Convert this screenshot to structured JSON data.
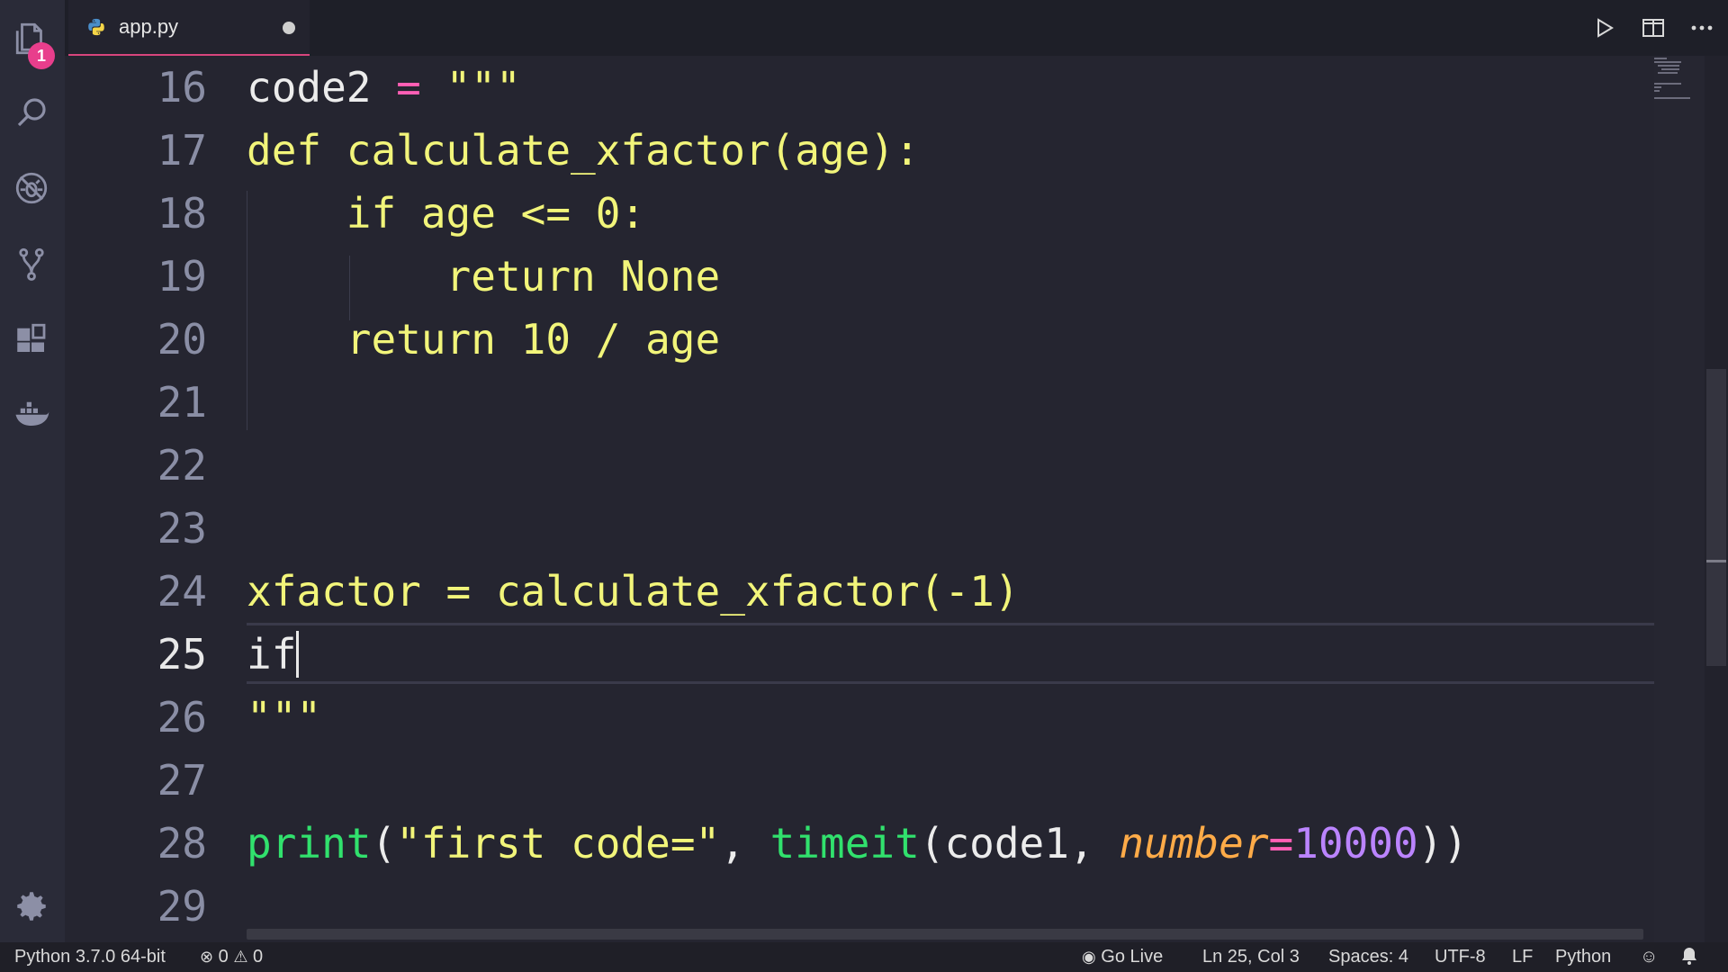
{
  "tab": {
    "filename": "app.py",
    "language_icon": "python-icon",
    "modified_icon": "dot-icon"
  },
  "activity_bar": {
    "explorer_badge": "1",
    "icons": [
      "files-icon",
      "search-icon",
      "debug-icon",
      "source-control-icon",
      "extensions-icon",
      "docker-icon",
      "gear-icon"
    ]
  },
  "tab_actions": [
    "run-icon",
    "split-editor-icon",
    "more-icon"
  ],
  "editor": {
    "lines": [
      {
        "n": "16",
        "tokens": [
          [
            "code2 ",
            "plain"
          ],
          [
            "=",
            "op"
          ],
          [
            " \"\"\"",
            "str"
          ]
        ]
      },
      {
        "n": "17",
        "tokens": [
          [
            "def calculate_xfactor(age):",
            "str"
          ]
        ]
      },
      {
        "n": "18",
        "tokens": [
          [
            "    if age <= 0:",
            "str"
          ]
        ]
      },
      {
        "n": "19",
        "tokens": [
          [
            "        return None",
            "str"
          ]
        ]
      },
      {
        "n": "20",
        "tokens": [
          [
            "    return 10 / age",
            "str"
          ]
        ]
      },
      {
        "n": "21",
        "tokens": []
      },
      {
        "n": "22",
        "tokens": []
      },
      {
        "n": "23",
        "tokens": []
      },
      {
        "n": "24",
        "tokens": [
          [
            "xfactor = calculate_xfactor(-1)",
            "str"
          ]
        ]
      },
      {
        "n": "25",
        "tokens": [
          [
            "if",
            "plain"
          ]
        ],
        "current": true
      },
      {
        "n": "26",
        "tokens": [
          [
            "\"\"\"",
            "str"
          ]
        ]
      },
      {
        "n": "27",
        "tokens": []
      },
      {
        "n": "28",
        "tokens": [
          [
            "print",
            "fn"
          ],
          [
            "(",
            "plain"
          ],
          [
            "\"first code=\"",
            "str"
          ],
          [
            ", ",
            "plain"
          ],
          [
            "timeit",
            "fn"
          ],
          [
            "(code1, ",
            "plain"
          ],
          [
            "number",
            "param"
          ],
          [
            "=",
            "op"
          ],
          [
            "10000",
            "num"
          ],
          [
            "))",
            "plain"
          ]
        ]
      },
      {
        "n": "29",
        "tokens": []
      }
    ]
  },
  "status_bar": {
    "interpreter": "Python 3.7.0 64-bit",
    "errors": "0",
    "warnings": "0",
    "go_live": "Go Live",
    "cursor_position": "Ln 25, Col 3",
    "indentation": "Spaces: 4",
    "encoding": "UTF-8",
    "line_ending": "LF",
    "language_mode": "Python"
  }
}
